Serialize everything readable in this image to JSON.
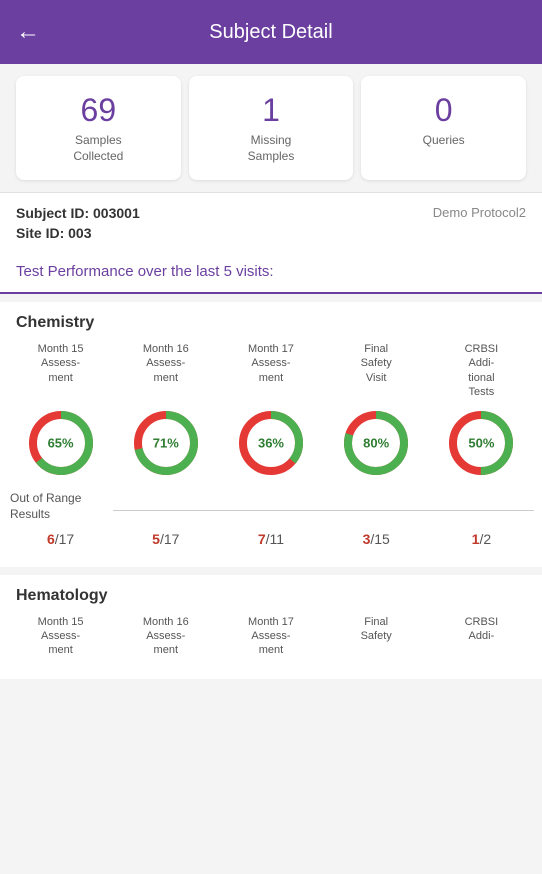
{
  "header": {
    "title": "Subject Detail",
    "back_label": "←"
  },
  "stats": [
    {
      "number": "69",
      "label": "Samples\nCollected"
    },
    {
      "number": "1",
      "label": "Missing\nSamples"
    },
    {
      "number": "0",
      "label": "Queries"
    }
  ],
  "subject": {
    "id_label": "Subject ID:",
    "id_value": "003001",
    "site_label": "Site ID:",
    "site_value": "003",
    "protocol": "Demo Protocol2"
  },
  "test_performance": {
    "title": "Test Performance over the last 5 visits:"
  },
  "chemistry": {
    "section_title": "Chemistry",
    "visits": [
      {
        "label": "Month 15 Assess-ment"
      },
      {
        "label": "Month 16 Assess-ment"
      },
      {
        "label": "Month 17 Assess-ment"
      },
      {
        "label": "Final Safety Visit"
      },
      {
        "label": "CRBSI Addi-tional Tests"
      }
    ],
    "donuts": [
      {
        "percent": 65,
        "green": 65,
        "red": 35,
        "label": "65%"
      },
      {
        "percent": 71,
        "green": 71,
        "red": 29,
        "label": "71%"
      },
      {
        "percent": 36,
        "green": 36,
        "red": 64,
        "label": "36%"
      },
      {
        "percent": 80,
        "green": 80,
        "red": 20,
        "label": "80%"
      },
      {
        "percent": 50,
        "green": 50,
        "red": 50,
        "label": "50%"
      }
    ],
    "out_of_range_label": "Out of Range Results",
    "fractions": [
      {
        "numerator": "6",
        "denominator": "/17"
      },
      {
        "numerator": "5",
        "denominator": "/17"
      },
      {
        "numerator": "7",
        "denominator": "/11"
      },
      {
        "numerator": "3",
        "denominator": "/15"
      },
      {
        "numerator": "1",
        "denominator": "/2"
      }
    ]
  },
  "hematology": {
    "section_title": "Hematology",
    "visits": [
      {
        "label": "Month 15 Assess-ment"
      },
      {
        "label": "Month 16 Assess-ment"
      },
      {
        "label": "Month 17 Assess-ment"
      },
      {
        "label": "Final Safety"
      },
      {
        "label": "CRBSI Addi-"
      }
    ]
  },
  "colors": {
    "purple": "#6b3fa0",
    "green": "#2e7d32",
    "red": "#c0392b",
    "green_ring": "#4caf50",
    "red_ring": "#e53935"
  }
}
